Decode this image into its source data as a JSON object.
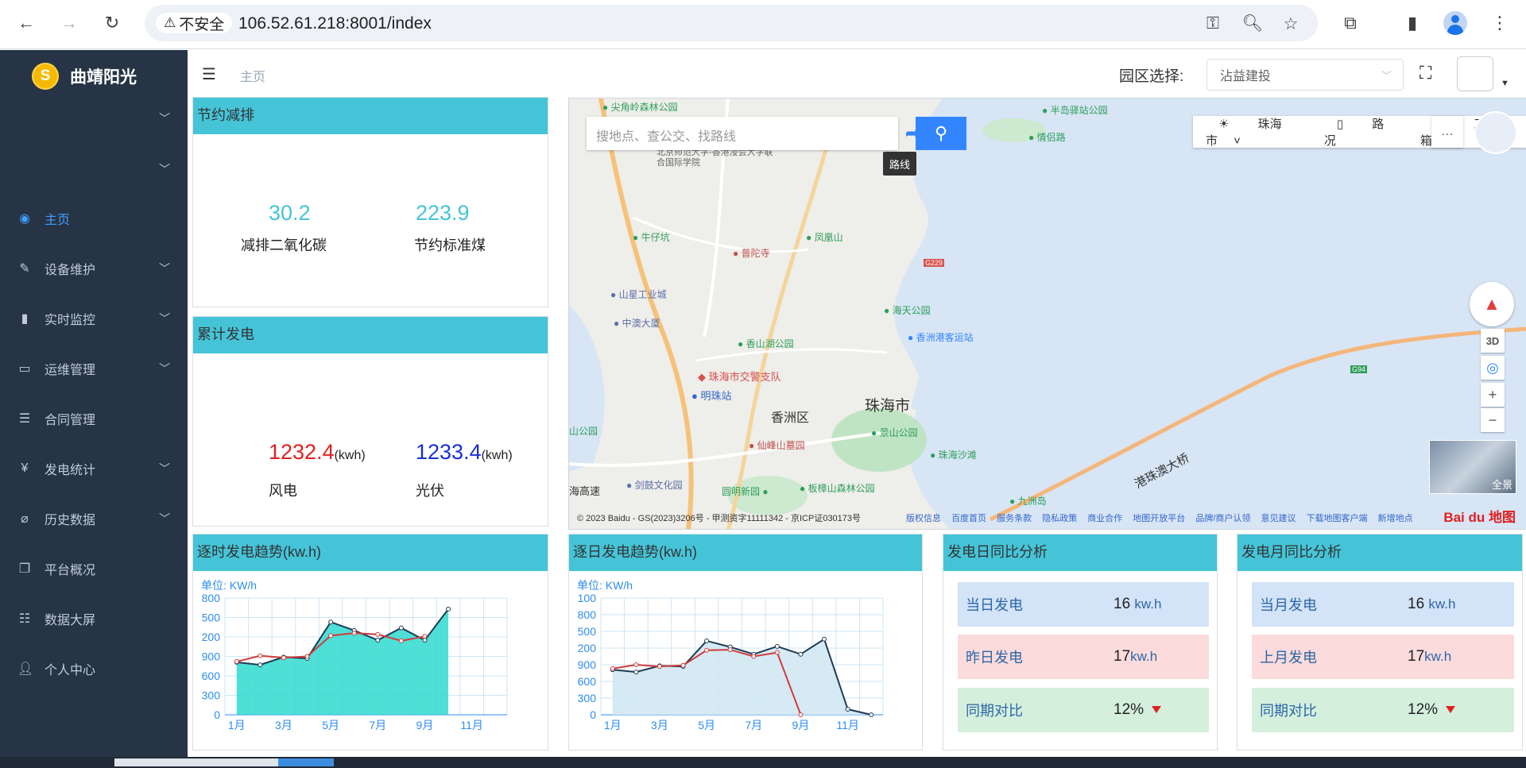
{
  "browser": {
    "security_label": "不安全",
    "url": "106.52.61.218:8001/index"
  },
  "sidebar": {
    "logo_letter": "S",
    "app_name": "曲靖阳光",
    "items": [
      {
        "label": "主页",
        "icon": "dashboard-icon",
        "active": true,
        "has_children": false
      },
      {
        "label": "设备维护",
        "icon": "edit-icon",
        "has_children": true
      },
      {
        "label": "实时监控",
        "icon": "bar-chart-icon",
        "has_children": true
      },
      {
        "label": "运维管理",
        "icon": "monitor-icon",
        "has_children": true
      },
      {
        "label": "合同管理",
        "icon": "list-icon",
        "has_children": false
      },
      {
        "label": "发电统计",
        "icon": "yen-icon",
        "has_children": true
      },
      {
        "label": "历史数据",
        "icon": "paperclip-icon",
        "has_children": true
      },
      {
        "label": "平台概况",
        "icon": "copy-icon",
        "has_children": false
      },
      {
        "label": "数据大屏",
        "icon": "list-icon",
        "has_children": false
      },
      {
        "label": "个人中心",
        "icon": "user-icon",
        "has_children": false
      }
    ]
  },
  "topnav": {
    "breadcrumb": "主页",
    "park_label": "园区选择:",
    "park_value": "沾益建投"
  },
  "energy_saving": {
    "title": "节约减排",
    "co2_value": "30.2",
    "co2_label": "减排二氧化碳",
    "coal_value": "223.9",
    "coal_label": "节约标准煤"
  },
  "cumulative": {
    "title": "累计发电",
    "wind_value": "1232.4",
    "wind_unit": "(kwh)",
    "wind_label": "风电",
    "pv_value": "1233.4",
    "pv_unit": "(kwh)",
    "pv_label": "光伏"
  },
  "map": {
    "search_placeholder": "搜地点、查公交、找路线",
    "route_tip": "路线",
    "city_selector": "珠海市",
    "traffic_label": "路况",
    "toolbox_label": "工具箱",
    "btn_3d": "3D",
    "pano_label": "全景",
    "copyright": "© 2023 Baidu - GS(2023)3206号 - 甲测资字11111342 - 京ICP证030173号",
    "links": [
      "版权信息",
      "百度首页",
      "服务条款",
      "隐私政策",
      "商业合作",
      "地图开放平台",
      "品牌/商户认领",
      "意见建议",
      "下载地图客户端",
      "新增地点"
    ],
    "logo": "Bai du 地图",
    "labels": [
      {
        "text": "珠海市",
        "kind": "city"
      },
      {
        "text": "香洲区",
        "kind": "district"
      },
      {
        "text": "港珠澳大桥",
        "kind": "road"
      },
      {
        "text": "尖角岭森林公园",
        "kind": "park"
      },
      {
        "text": "半岛驿站公园",
        "kind": "park"
      },
      {
        "text": "情侣路",
        "kind": "park"
      },
      {
        "text": "北京师范大学-香港浸会大学联合国际学院",
        "kind": "poi"
      },
      {
        "text": "牛仔坑",
        "kind": "park"
      },
      {
        "text": "凤凰山",
        "kind": "park"
      },
      {
        "text": "普陀寺",
        "kind": "poi-red"
      },
      {
        "text": "山星工业城",
        "kind": "poi-blue"
      },
      {
        "text": "中澳大厦",
        "kind": "poi-blue"
      },
      {
        "text": "海天公园",
        "kind": "park"
      },
      {
        "text": "香洲港客运站",
        "kind": "poi-blue"
      },
      {
        "text": "香山湖公园",
        "kind": "park"
      },
      {
        "text": "珠海市交警支队",
        "kind": "poi-red"
      },
      {
        "text": "明珠站",
        "kind": "poi-blue"
      },
      {
        "text": "景山公园",
        "kind": "park"
      },
      {
        "text": "仙峰山墓园",
        "kind": "poi-red"
      },
      {
        "text": "珠海沙滩",
        "kind": "park"
      },
      {
        "text": "剑鼓文化园",
        "kind": "poi-blue"
      },
      {
        "text": "圆明新园",
        "kind": "park"
      },
      {
        "text": "板樟山森林公园",
        "kind": "park"
      },
      {
        "text": "九洲岛",
        "kind": "park"
      },
      {
        "text": "山公园",
        "kind": "park"
      },
      {
        "text": "海高速",
        "kind": "road-dark"
      },
      {
        "text": "G229",
        "kind": "shield"
      },
      {
        "text": "G94",
        "kind": "shield"
      }
    ]
  },
  "hourly_chart": {
    "title": "逐时发电趋势(kw.h)",
    "unit_label": "单位:  KW/h"
  },
  "daily_chart": {
    "title": "逐日发电趋势(kw.h)",
    "unit_label": "单位:  KW/h"
  },
  "day_compare": {
    "title": "发电日同比分析",
    "today_label": "当日发电",
    "today_value": "16",
    "today_unit": "kw.h",
    "yesterday_label": "昨日发电",
    "yesterday_value": "17",
    "yesterday_unit": "kw.h",
    "yoy_label": "同期对比",
    "yoy_value": "12%"
  },
  "month_compare": {
    "title": "发电月同比分析",
    "current_label": "当月发电",
    "current_value": "16",
    "current_unit": "kw.h",
    "last_label": "上月发电",
    "last_value": "17",
    "last_unit": "kw.h",
    "yoy_label": "同期对比",
    "yoy_value": "12%"
  },
  "colors": {
    "card_header": "#45c4d8",
    "sidebar_bg": "#263445",
    "active_menu": "#409eff",
    "wind_value": "#e02020",
    "pv_value": "#1a2ed8",
    "kpi_teal": "#45c4d8"
  },
  "chart_data": [
    {
      "type": "line",
      "name": "hourly",
      "categories": [
        "1月",
        "2月",
        "3月",
        "4月",
        "5月",
        "6月",
        "7月",
        "8月",
        "9月",
        "10月",
        "11月",
        "12月"
      ],
      "tick_labels": [
        "1月",
        "3月",
        "5月",
        "7月",
        "9月",
        "11月"
      ],
      "y_tick_labels": [
        "0",
        "300",
        "600",
        "900",
        "200",
        "500",
        "800"
      ],
      "series": [
        {
          "color": "#1f3b55",
          "fill": "#2fd9d0",
          "values": [
            810,
            770,
            890,
            870,
            1430,
            1300,
            1150,
            1340,
            1150,
            1630
          ]
        },
        {
          "color": "#d33a3a",
          "values": [
            820,
            910,
            880,
            900,
            1220,
            1260,
            1240,
            1140,
            1210
          ]
        }
      ],
      "ylim": [
        0,
        1800
      ],
      "grid": true
    },
    {
      "type": "line",
      "name": "daily",
      "categories": [
        "1月",
        "2月",
        "3月",
        "4月",
        "5月",
        "6月",
        "7月",
        "8月",
        "9月",
        "10月",
        "11月",
        "12月"
      ],
      "tick_labels": [
        "1月",
        "3月",
        "5月",
        "7月",
        "9月",
        "11月"
      ],
      "y_tick_labels": [
        "0",
        "300",
        "600",
        "900",
        "200",
        "500",
        "800",
        "100"
      ],
      "series": [
        {
          "color": "#1f3b55",
          "fill": "#cfe6f2",
          "values": [
            810,
            770,
            880,
            870,
            1330,
            1220,
            1090,
            1230,
            1090,
            1360,
            100,
            0
          ]
        },
        {
          "color": "#d33a3a",
          "values": [
            830,
            900,
            870,
            890,
            1160,
            1170,
            1050,
            1120,
            0
          ]
        }
      ],
      "ylim": [
        0,
        2100
      ],
      "grid": true
    }
  ]
}
